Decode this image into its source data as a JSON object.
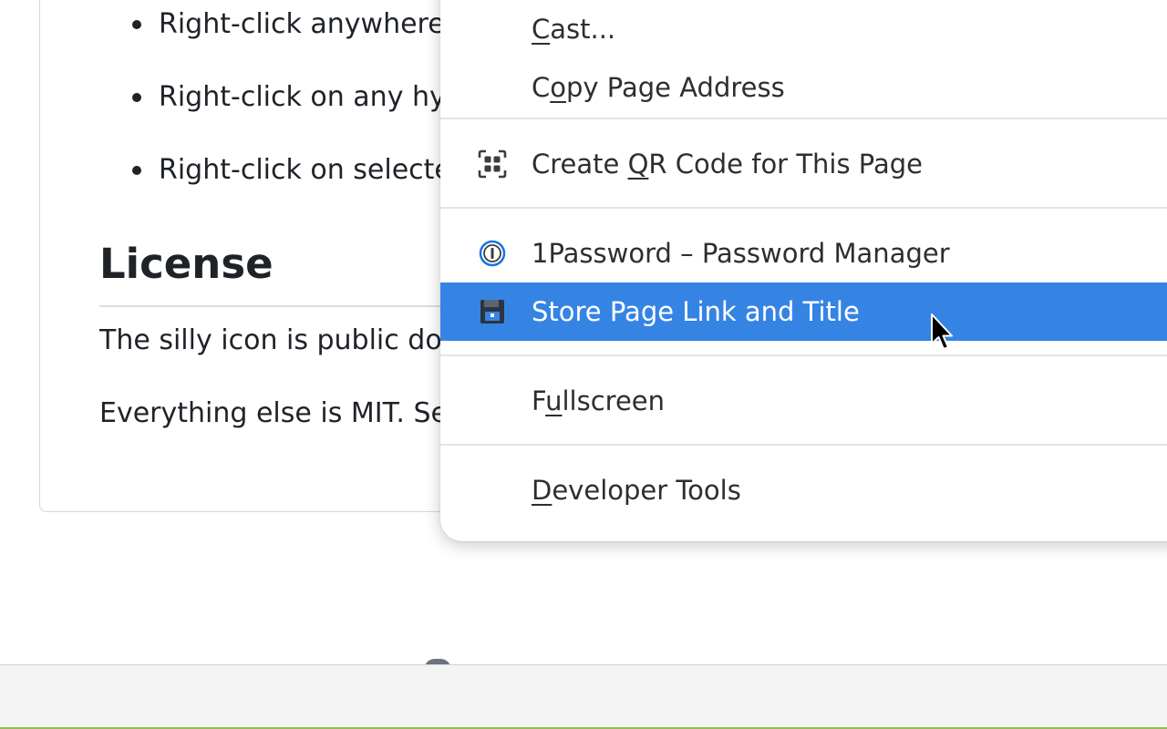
{
  "page": {
    "bullets": [
      "Right-click anywhere",
      "Right-click on any hy",
      "Right-click on selecte"
    ],
    "license_heading": "License",
    "paragraphs": [
      "The silly icon is public dor",
      "Everything else is MIT. Se"
    ]
  },
  "context_menu": {
    "items": [
      {
        "pre": "",
        "key": "C",
        "post": "ast...",
        "icon": "none"
      },
      {
        "pre": "C",
        "key": "o",
        "post": "py Page Address",
        "icon": "none"
      },
      {
        "pre": "Create ",
        "key": "Q",
        "post": "R Code for This Page",
        "icon": "qr-code-icon"
      },
      {
        "pre": "1Password – Password Manager",
        "key": "",
        "post": "",
        "icon": "1password-icon"
      },
      {
        "pre": "Store Page Link and Title",
        "key": "",
        "post": "",
        "icon": "floppy-disk-icon",
        "highlighted": true
      },
      {
        "pre": "F",
        "key": "u",
        "post": "llscreen",
        "icon": "none"
      },
      {
        "pre": "",
        "key": "D",
        "post": "eveloper Tools",
        "icon": "none"
      }
    ],
    "highlight_color": "#3584e4"
  },
  "colors": {
    "accent_bottom": "#8bc34a",
    "bottom_bar": "#f4f4f5"
  }
}
